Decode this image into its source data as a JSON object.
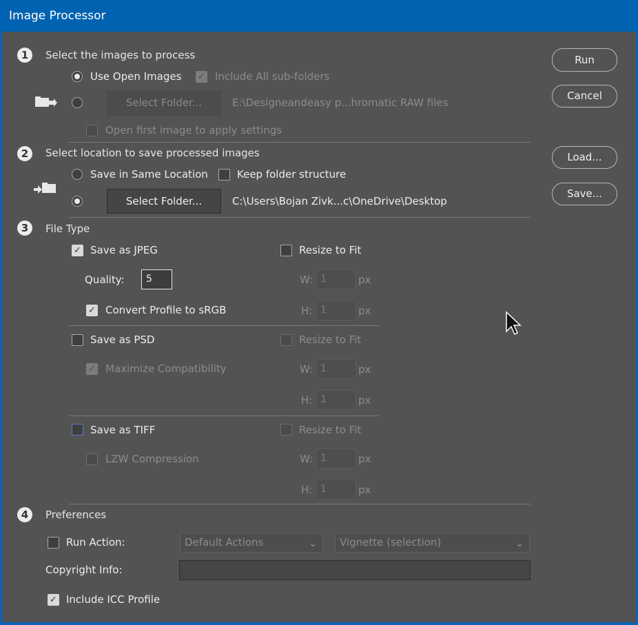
{
  "window": {
    "title": "Image Processor"
  },
  "buttons": {
    "run": "Run",
    "cancel": "Cancel",
    "load": "Load...",
    "save": "Save..."
  },
  "section1": {
    "num": "1",
    "title": "Select the images to process",
    "use_open_images": "Use Open Images",
    "include_subfolders": "Include All sub-folders",
    "select_folder": "Select Folder...",
    "folder_path": "E:\\Designeandeasy p...hromatic RAW files",
    "open_first_image": "Open first image to apply settings"
  },
  "section2": {
    "num": "2",
    "title": "Select location to save processed images",
    "save_same_location": "Save in Same Location",
    "keep_folder_structure": "Keep folder structure",
    "select_folder": "Select Folder...",
    "folder_path": "C:\\Users\\Bojan Zivk...c\\OneDrive\\Desktop"
  },
  "section3": {
    "num": "3",
    "title": "File Type",
    "jpeg": {
      "save_label": "Save as JPEG",
      "resize_label": "Resize to Fit",
      "quality_label": "Quality:",
      "quality_value": "5",
      "convert_profile": "Convert Profile to sRGB",
      "w_label": "W:",
      "w_value": "1",
      "h_label": "H:",
      "h_value": "1",
      "unit": "px"
    },
    "psd": {
      "save_label": "Save as PSD",
      "resize_label": "Resize to Fit",
      "maximize": "Maximize Compatibility",
      "w_label": "W:",
      "w_value": "1",
      "h_label": "H:",
      "h_value": "1",
      "unit": "px"
    },
    "tiff": {
      "save_label": "Save as TIFF",
      "resize_label": "Resize to Fit",
      "lzw": "LZW Compression",
      "w_label": "W:",
      "w_value": "1",
      "h_label": "H:",
      "h_value": "1",
      "unit": "px"
    }
  },
  "section4": {
    "num": "4",
    "title": "Preferences",
    "run_action": "Run Action:",
    "action_set": "Default Actions",
    "action": "Vignette (selection)",
    "copyright_label": "Copyright Info:",
    "copyright_value": "",
    "include_icc": "Include ICC Profile"
  },
  "check_glyph": "✓"
}
